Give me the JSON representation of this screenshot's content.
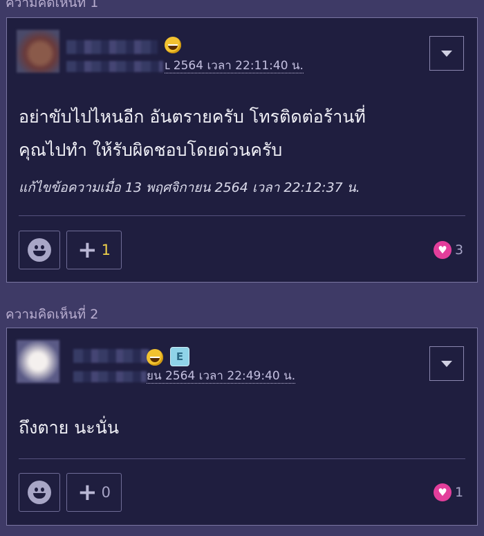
{
  "comments": [
    {
      "label": "ความคิดเห็นที่ 1",
      "date": "ւ 2564 เวลา 22:11:40 น.",
      "body_lines": [
        "อย่าขับไปไหนอีก อันตรายครับ โทรติดต่อร้านที่",
        "คุณไปทำ ให้รับผิดชอบโดยด่วนครับ"
      ],
      "edited": "แก้ไขข้อความเมื่อ 13 พฤศจิกายน 2564 เวลา 22:12:37 น.",
      "plus_count": "1",
      "plus_color": "#f0d24a",
      "heart_count": "3"
    },
    {
      "label": "ความคิดเห็นที่ 2",
      "date": "ยน 2564 เวลา 22:49:40 น.",
      "body_lines": [
        "ถึงตาย นะนั่น"
      ],
      "edited": "",
      "plus_count": "0",
      "plus_color": "#a7a4c6",
      "heart_count": "1",
      "badge": "E"
    }
  ],
  "icons": {
    "menu": "chevron-down-icon",
    "emoji_react": "smiley-icon",
    "plus": "plus-icon",
    "heart": "heart-icon"
  },
  "colors": {
    "page_bg": "#3e3a66",
    "card_bg": "#1f1e3f",
    "heart": "#e33e9b"
  }
}
